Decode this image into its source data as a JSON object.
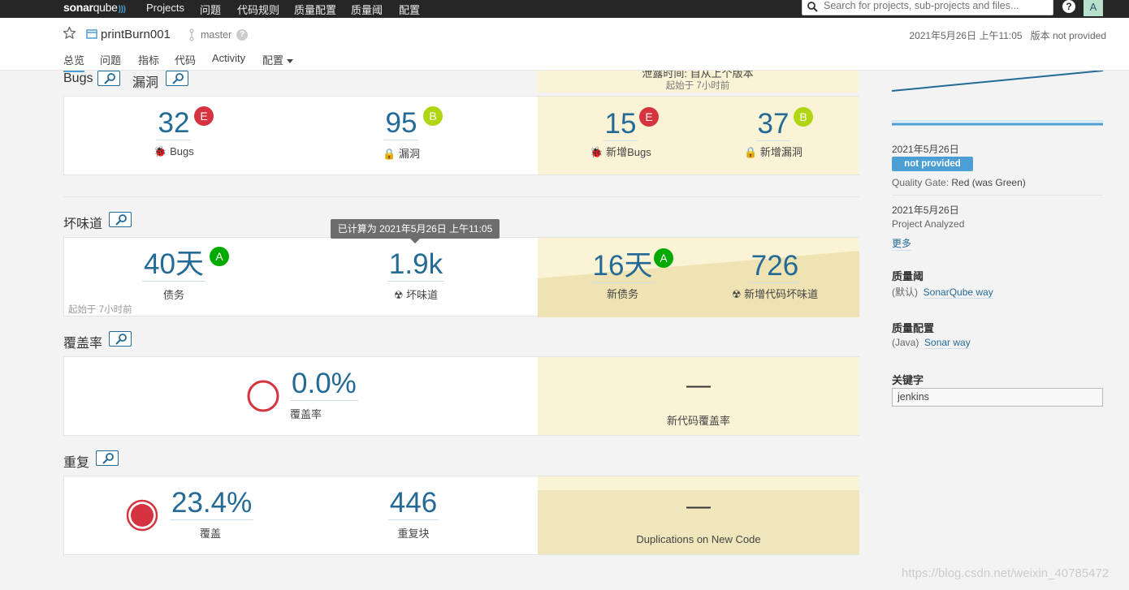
{
  "topnav": {
    "logo_main": "sonar",
    "logo_q": "qube",
    "items": [
      "Projects",
      "问题",
      "代码规则",
      "质量配置",
      "质量阈",
      "配置"
    ],
    "search_placeholder": "Search for projects, sub-projects and files...",
    "help": "?",
    "avatar": "A"
  },
  "project": {
    "name": "printBurn001",
    "branch": "master",
    "analysis_date": "2021年5月26日 上午11:05",
    "version": "版本 not provided"
  },
  "tabs": [
    "总览",
    "问题",
    "指标",
    "代码",
    "Activity",
    "配置"
  ],
  "leak_header": {
    "period_partial": "泄露时间: 自从上个版本",
    "since": "起始于 7小时前"
  },
  "reliability": {
    "bugs_title": "Bugs",
    "vuln_title": "漏洞",
    "bugs": {
      "value": "32",
      "rating": "E",
      "label": "Bugs"
    },
    "vulnerabilities": {
      "value": "95",
      "rating": "B",
      "label": "漏洞"
    },
    "new_bugs": {
      "value": "15",
      "rating": "E",
      "label": "新增Bugs"
    },
    "new_vulnerabilities": {
      "value": "37",
      "rating": "B",
      "label": "新增漏洞"
    }
  },
  "maintainability": {
    "title": "坏味道",
    "tooltip": "已计算为 2021年5月26日 上午11:05",
    "debt": {
      "value": "40天",
      "rating": "A",
      "label": "债务"
    },
    "since": "起始于 7小时前",
    "smells": {
      "value": "1.9k",
      "label": "坏味道"
    },
    "new_debt": {
      "value": "16天",
      "rating": "A",
      "label": "新债务"
    },
    "new_smells": {
      "value": "726",
      "label": "新增代码坏味道"
    }
  },
  "coverage": {
    "title": "覆盖率",
    "value": "0.0%",
    "label": "覆盖率",
    "new_value": "—",
    "new_label": "新代码覆盖率"
  },
  "duplications": {
    "title": "重复",
    "value": "23.4%",
    "label": "覆盖",
    "blocks_value": "446",
    "blocks_label": "重复块",
    "new_value": "—",
    "new_label": "Duplications on New Code"
  },
  "sidebar": {
    "event1_date": "2021年5月26日",
    "event1_badge": "not provided",
    "event1_gate_prefix": "Quality Gate: ",
    "event1_gate_value": "Red (was Green)",
    "event2_date": "2021年5月26日",
    "event2_text": "Project Analyzed",
    "more": "更多",
    "qg_title": "质量阈",
    "qg_default": "(默认)",
    "qg_link": "SonarQube way",
    "qp_title": "质量配置",
    "qp_lang": "(Java)",
    "qp_link": "Sonar way",
    "tags_title": "关键字",
    "tag": "jenkins"
  },
  "watermark": "https://blog.csdn.net/weixin_40785472",
  "colors": {
    "accent": "#4b9fd5",
    "link": "#236a97",
    "rating_E": "#d4333f",
    "rating_B": "#b0d513",
    "rating_A": "#00aa00",
    "leak_bg": "#fbf3d5"
  }
}
